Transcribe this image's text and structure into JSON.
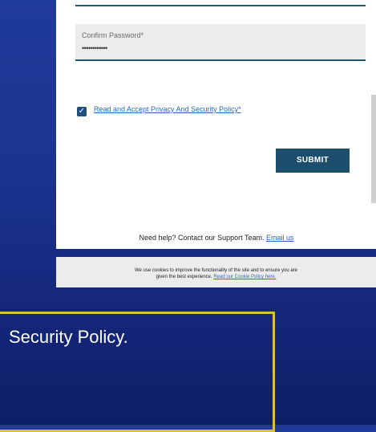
{
  "form": {
    "confirm_password_label": "Confirm Password*",
    "confirm_password_value": "••••••••••••",
    "policy_checked": true,
    "policy_link": "Read and Accept Privacy And Security Policy*",
    "submit_label": "SUBMIT",
    "help_text": "Need help? Contact our Support Team.",
    "help_link": "Email us"
  },
  "cookie": {
    "line1": "We use cookies to improve the functionality of the site and to ensure you are",
    "line2_prefix": "given the best experience.",
    "link": "Read our Cookie Policy here."
  },
  "caption": {
    "text": "Security Policy."
  },
  "colors": {
    "accent": "#1e4e6e",
    "link": "#2b67c2",
    "caption_border": "#d9c23a"
  },
  "icons": {
    "checkbox": "checkmark-icon"
  }
}
